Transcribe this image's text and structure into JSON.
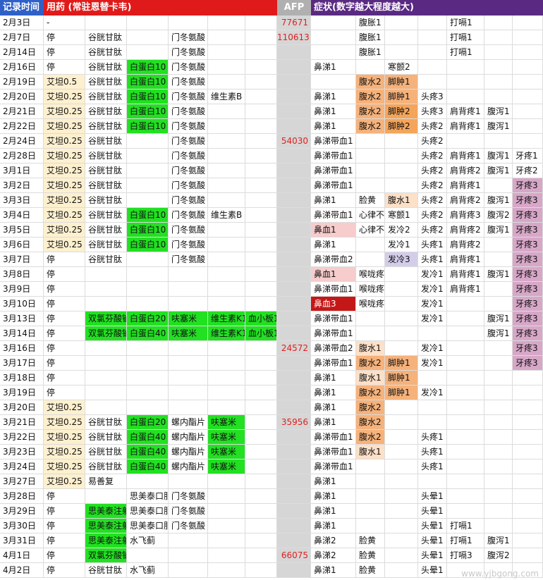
{
  "headers": {
    "date": "记录时间",
    "med": "用药 (常驻恩替卡韦)",
    "afp": "AFP",
    "sym": "症状(数字越大程度越大)"
  },
  "colors": {
    "header_date_bg": "#2e60c8",
    "header_med_bg": "#e01a1a",
    "header_afp_bg": "#b0b0b0",
    "header_sym_bg": "#5a2a82",
    "afp_column_bg": "#d6d6d6",
    "afp_text": "#e02020"
  },
  "watermark": "www.yjbgong.com",
  "rows": [
    {
      "date": "2月3日",
      "cells": {
        "m1": "-",
        "afp": "77671",
        "s2": "腹胀1",
        "s5": "打嗝1"
      }
    },
    {
      "date": "2月7日",
      "cells": {
        "m1": "停",
        "m2": "谷胱甘肽",
        "m4": "门冬氨酸",
        "afp": "110613",
        "s2": "腹胀1",
        "s5": "打嗝1"
      }
    },
    {
      "date": "2月14日",
      "cells": {
        "m1": "停",
        "m2": "谷胱甘肽",
        "m4": "门冬氨酸",
        "s2": "腹胀1",
        "s5": "打嗝1"
      }
    },
    {
      "date": "2月16日",
      "cells": {
        "m1": "停",
        "m2": "谷胱甘肽",
        "m3": "白蛋白10",
        "m4": "门冬氨酸",
        "s1": "鼻涕1",
        "s3": "寒颤2"
      }
    },
    {
      "date": "2月19日",
      "cells": {
        "m1": "艾坦0.5",
        "m2": "谷胱甘肽",
        "m3": "白蛋白10",
        "m4": "门冬氨酸",
        "s2": "腹水2",
        "s3": "脚肿1"
      }
    },
    {
      "date": "2月20日",
      "cells": {
        "m1": "艾坦0.25",
        "m2": "谷胱甘肽",
        "m3": "白蛋白10",
        "m4": "门冬氨酸",
        "m5": "维生素B",
        "s1": "鼻涕1",
        "s2": "腹水2",
        "s3": "脚肿1",
        "s4": "头疼3"
      }
    },
    {
      "date": "2月21日",
      "cells": {
        "m1": "艾坦0.25",
        "m2": "谷胱甘肽",
        "m3": "白蛋白10",
        "m4": "门冬氨酸",
        "s1": "鼻涕1",
        "s2": "腹水2",
        "s3": "脚肿2",
        "s4": "头疼3",
        "s5": "肩背疼1",
        "s6": "腹泻1"
      }
    },
    {
      "date": "2月22日",
      "cells": {
        "m1": "艾坦0.25",
        "m2": "谷胱甘肽",
        "m3": "白蛋白10",
        "m4": "门冬氨酸",
        "s1": "鼻涕1",
        "s2": "腹水2",
        "s3": "脚肿2",
        "s4": "头疼2",
        "s5": "肩背疼1",
        "s6": "腹泻1"
      }
    },
    {
      "date": "2月24日",
      "cells": {
        "m1": "艾坦0.25",
        "m2": "谷胱甘肽",
        "m4": "门冬氨酸",
        "afp": "54030",
        "s1": "鼻涕带血1",
        "s4": "头疼2"
      }
    },
    {
      "date": "2月28日",
      "cells": {
        "m1": "艾坦0.25",
        "m2": "谷胱甘肽",
        "m4": "门冬氨酸",
        "s1": "鼻涕带血1",
        "s4": "头疼2",
        "s5": "肩背疼1",
        "s6": "腹泻1",
        "s7": "牙疼1"
      }
    },
    {
      "date": "3月1日",
      "cells": {
        "m1": "艾坦0.25",
        "m2": "谷胱甘肽",
        "m4": "门冬氨酸",
        "s1": "鼻涕带血1",
        "s4": "头疼2",
        "s5": "肩背疼2",
        "s6": "腹泻1",
        "s7": "牙疼2"
      }
    },
    {
      "date": "3月2日",
      "cells": {
        "m1": "艾坦0.25",
        "m2": "谷胱甘肽",
        "m4": "门冬氨酸",
        "s1": "鼻涕带血1",
        "s4": "头疼2",
        "s5": "肩背疼1",
        "s7": "牙疼3"
      }
    },
    {
      "date": "3月3日",
      "cells": {
        "m1": "艾坦0.25",
        "m2": "谷胱甘肽",
        "m4": "门冬氨酸",
        "s1": "鼻涕1",
        "s2": "脸黄",
        "s3": "腹水1",
        "s4": "头疼2",
        "s5": "肩背疼2",
        "s6": "腹泻1",
        "s7": "牙疼3"
      }
    },
    {
      "date": "3月4日",
      "cells": {
        "m1": "艾坦0.25",
        "m2": "谷胱甘肽",
        "m3": "白蛋白10",
        "m4": "门冬氨酸",
        "m5": "维生素B",
        "s1": "鼻涕带血1",
        "s2": "心律不齐",
        "s3": "寒颤1",
        "s4": "头疼2",
        "s5": "肩背疼3",
        "s6": "腹泻2",
        "s7": "牙疼3"
      }
    },
    {
      "date": "3月5日",
      "cells": {
        "m1": "艾坦0.25",
        "m2": "谷胱甘肽",
        "m3": "白蛋白10",
        "m4": "门冬氨酸",
        "s1": "鼻血1",
        "s2": "心律不齐",
        "s3": "发冷2",
        "s4": "头疼2",
        "s5": "肩背疼2",
        "s6": "腹泻1",
        "s7": "牙疼3"
      }
    },
    {
      "date": "3月6日",
      "cells": {
        "m1": "艾坦0.25",
        "m2": "谷胱甘肽",
        "m3": "白蛋白10",
        "m4": "门冬氨酸",
        "s1": "鼻涕1",
        "s3": "发冷1",
        "s4": "头疼1",
        "s5": "肩背疼2",
        "s7": "牙疼3"
      }
    },
    {
      "date": "3月7日",
      "cells": {
        "m1": "停",
        "m2": "谷胱甘肽",
        "m4": "门冬氨酸",
        "s1": "鼻涕带血2",
        "s3": "发冷3",
        "s4": "头疼1",
        "s5": "肩背疼1",
        "s7": "牙疼3"
      }
    },
    {
      "date": "3月8日",
      "cells": {
        "m1": "停",
        "s1": "鼻血1",
        "s2": "喉咙疼1",
        "s4": "发冷1",
        "s5": "肩背疼1",
        "s6": "腹泻1",
        "s7": "牙疼3"
      }
    },
    {
      "date": "3月9日",
      "cells": {
        "m1": "停",
        "s1": "鼻涕带血1",
        "s2": "喉咙疼1",
        "s4": "发冷1",
        "s5": "肩背疼1",
        "s7": "牙疼3"
      }
    },
    {
      "date": "3月10日",
      "cells": {
        "m1": "停",
        "s1": "鼻血3",
        "s2": "喉咙疼1",
        "s4": "发冷1",
        "s7": "牙疼3"
      }
    },
    {
      "date": "3月13日",
      "cells": {
        "m1": "停",
        "m2": "双氯芬酸钠",
        "m3": "白蛋白20",
        "m4": "呋塞米",
        "m5": "维生素K1",
        "m6": "血小板1",
        "s1": "鼻涕带血1",
        "s4": "发冷1",
        "s6": "腹泻1",
        "s7": "牙疼3"
      }
    },
    {
      "date": "3月14日",
      "cells": {
        "m1": "停",
        "m2": "双氯芬酸钠",
        "m3": "白蛋白40",
        "m4": "呋塞米",
        "m5": "维生素K1",
        "m6": "血小板1",
        "s1": "鼻涕带血1",
        "s6": "腹泻1",
        "s7": "牙疼3"
      }
    },
    {
      "date": "3月16日",
      "cells": {
        "m1": "停",
        "afp": "24572",
        "s1": "鼻涕带血2",
        "s2": "腹水1",
        "s4": "发冷1",
        "s7": "牙疼3"
      }
    },
    {
      "date": "3月17日",
      "cells": {
        "m1": "停",
        "s1": "鼻涕带血1",
        "s2": "腹水2",
        "s3": "脚肿1",
        "s4": "发冷1",
        "s7": "牙疼3"
      }
    },
    {
      "date": "3月18日",
      "cells": {
        "m1": "停",
        "s1": "鼻涕1",
        "s2": "腹水1",
        "s3": "脚肿1"
      }
    },
    {
      "date": "3月19日",
      "cells": {
        "m1": "停",
        "s1": "鼻涕1",
        "s2": "腹水2",
        "s3": "脚肿1",
        "s4": "发冷1"
      }
    },
    {
      "date": "3月20日",
      "cells": {
        "m1": "艾坦0.25",
        "s1": "鼻涕1",
        "s2": "腹水2"
      }
    },
    {
      "date": "3月21日",
      "cells": {
        "m1": "艾坦0.25",
        "m2": "谷胱甘肽",
        "m3": "白蛋白20",
        "m4": "螺内酯片",
        "m5": "呋塞米",
        "afp": "35956",
        "s1": "鼻涕1",
        "s2": "腹水2"
      }
    },
    {
      "date": "3月22日",
      "cells": {
        "m1": "艾坦0.25",
        "m2": "谷胱甘肽",
        "m3": "白蛋白40",
        "m4": "螺内酯片",
        "m5": "呋塞米",
        "s1": "鼻涕带血1",
        "s2": "腹水2",
        "s4": "头疼1"
      }
    },
    {
      "date": "3月23日",
      "cells": {
        "m1": "艾坦0.25",
        "m2": "谷胱甘肽",
        "m3": "白蛋白40",
        "m4": "螺内酯片",
        "m5": "呋塞米",
        "s1": "鼻涕带血1",
        "s2": "腹水1",
        "s4": "头疼1"
      }
    },
    {
      "date": "3月24日",
      "cells": {
        "m1": "艾坦0.25",
        "m2": "谷胱甘肽",
        "m3": "白蛋白40",
        "m4": "螺内酯片",
        "m5": "呋塞米",
        "s1": "鼻涕带血1",
        "s4": "头疼1"
      }
    },
    {
      "date": "3月27日",
      "cells": {
        "m1": "艾坦0.25",
        "m2": "易善复",
        "s1": "鼻涕1"
      }
    },
    {
      "date": "3月28日",
      "cells": {
        "m1": "停",
        "m3": "思美泰口服",
        "m4": "门冬氨酸",
        "s1": "鼻涕1",
        "s4": "头晕1"
      }
    },
    {
      "date": "3月29日",
      "cells": {
        "m1": "停",
        "m2": "思美泰注射",
        "m3": "思美泰口服",
        "m4": "门冬氨酸",
        "s1": "鼻涕1",
        "s4": "头晕1"
      }
    },
    {
      "date": "3月30日",
      "cells": {
        "m1": "停",
        "m2": "思美泰注射",
        "m3": "思美泰口服",
        "m4": "门冬氨酸",
        "s1": "鼻涕1",
        "s4": "头晕1",
        "s5": "打嗝1"
      }
    },
    {
      "date": "3月31日",
      "cells": {
        "m1": "停",
        "m2": "思美泰注射",
        "m3": "水飞蓟",
        "s1": "鼻涕2",
        "s2": "脸黄",
        "s4": "头晕1",
        "s5": "打嗝1",
        "s6": "腹泻1"
      }
    },
    {
      "date": "4月1日",
      "cells": {
        "m1": "停",
        "m2": "双氯芬酸钠",
        "afp": "66075",
        "s1": "鼻涕2",
        "s2": "脸黄",
        "s4": "头晕1",
        "s5": "打嗝3",
        "s6": "腹泻2"
      }
    },
    {
      "date": "4月2日",
      "cells": {
        "m1": "停",
        "m2": "谷胱甘肽",
        "m3": "水飞蓟",
        "s1": "鼻涕1",
        "s2": "脸黄",
        "s4": "头晕1"
      }
    }
  ]
}
